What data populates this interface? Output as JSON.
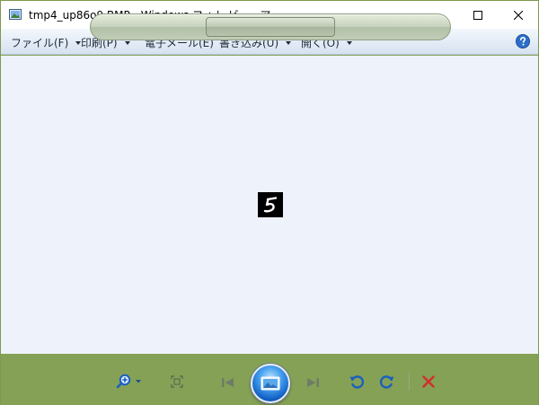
{
  "window": {
    "title": "tmp4_up86o9.BMP - Windows フォト ビューアー"
  },
  "menu": {
    "items": [
      {
        "label": "ファイル(F)",
        "has_dropdown": true
      },
      {
        "label": "印刷(P)",
        "has_dropdown": true
      },
      {
        "label": "電子メール(E)",
        "has_dropdown": false
      },
      {
        "label": "書き込み(U)",
        "has_dropdown": true
      },
      {
        "label": "開く(O)",
        "has_dropdown": true
      }
    ]
  },
  "viewer": {
    "background": "#eef2fa",
    "image_background": "#000000"
  },
  "controls": {
    "icons": [
      "zoom-icon",
      "actual-size-icon",
      "previous-icon",
      "slideshow-icon",
      "next-icon",
      "rotate-left-icon",
      "rotate-right-icon",
      "delete-icon"
    ]
  },
  "colors": {
    "frame": "#85a155",
    "accent_blue": "#1a6fd6",
    "delete_red": "#d12f2f"
  }
}
